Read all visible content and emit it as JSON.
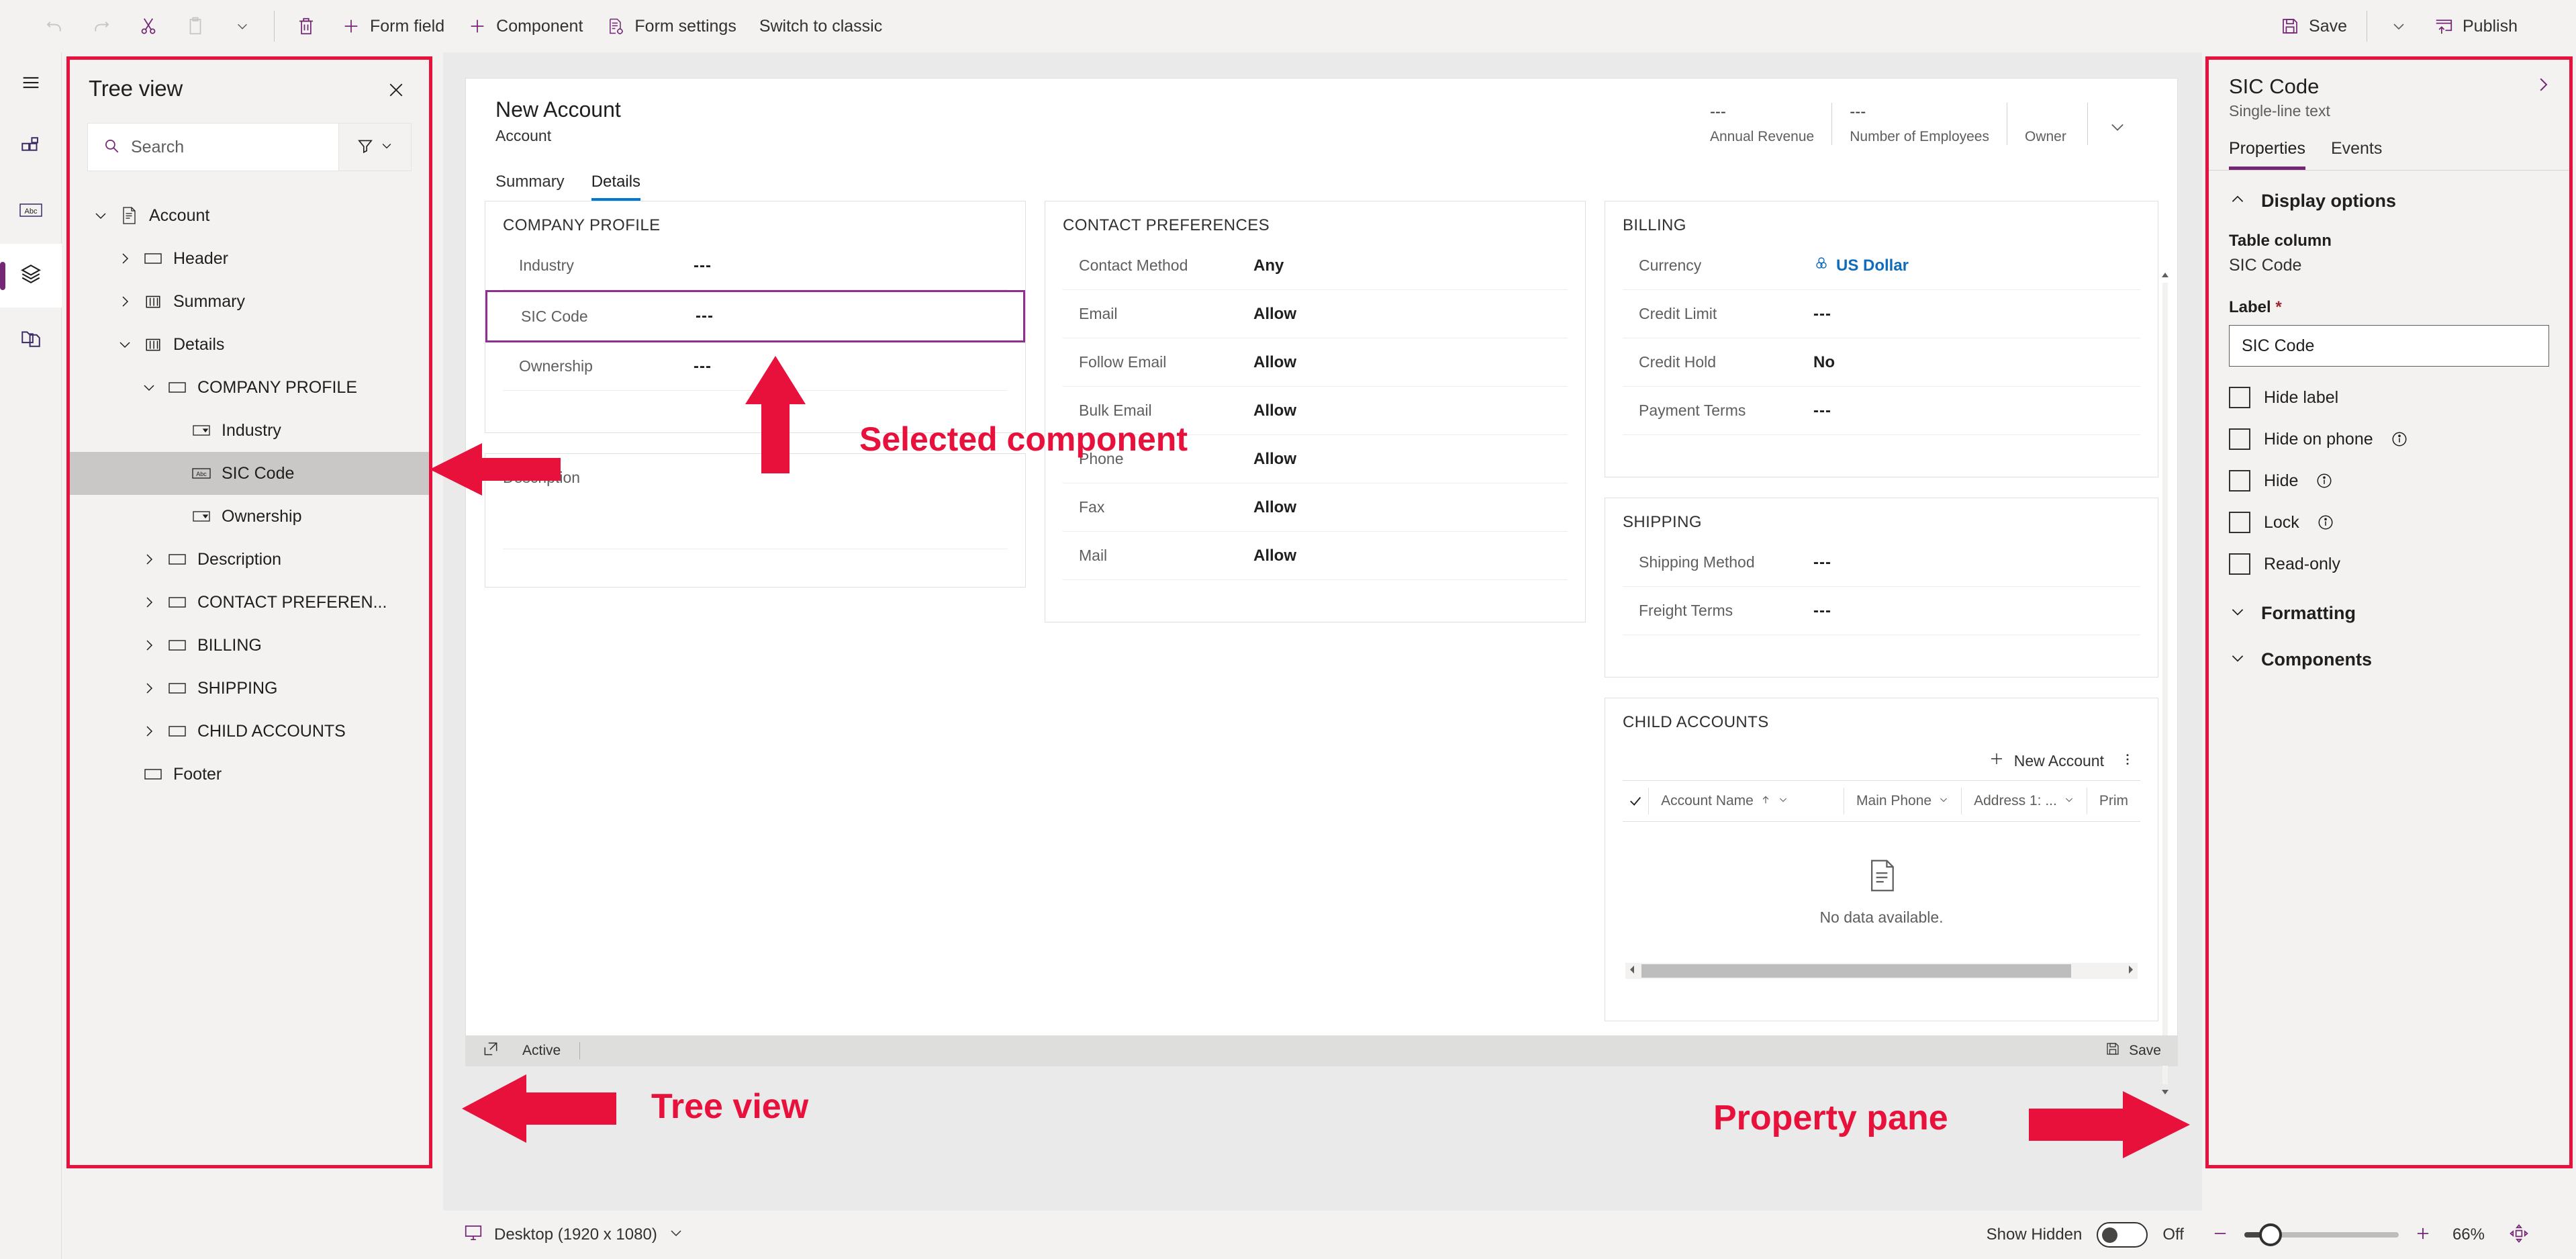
{
  "commandbar": {
    "buttons": [
      {
        "label": "",
        "icon": "undo-icon"
      },
      {
        "label": "",
        "icon": "redo-icon"
      },
      {
        "label": "",
        "icon": "cut-icon"
      },
      {
        "label": "",
        "icon": "paste-icon"
      },
      {
        "label": "",
        "icon": "chevron-down-icon"
      },
      {
        "label": "",
        "icon": "delete-icon"
      },
      {
        "label": "Form field",
        "icon": "plus-icon"
      },
      {
        "label": "Component",
        "icon": "plus-icon"
      },
      {
        "label": "Form settings",
        "icon": "form-settings-icon"
      },
      {
        "label": "Switch to classic",
        "icon": ""
      }
    ],
    "save_label": "Save",
    "publish_label": "Publish"
  },
  "rail": {
    "items": [
      {
        "name": "pages-icon"
      },
      {
        "name": "components-icon"
      },
      {
        "name": "table-columns-icon"
      },
      {
        "name": "tree-view-icon"
      },
      {
        "name": "related-icon"
      }
    ]
  },
  "treeview": {
    "title": "Tree view",
    "close_label": "Close",
    "search": {
      "placeholder": "Search",
      "value": ""
    },
    "items": [
      {
        "label": "Account",
        "depth": 0,
        "chev": "down",
        "icon": "form-icon",
        "selected": false
      },
      {
        "label": "Header",
        "depth": 1,
        "chev": "right",
        "icon": "section-icon",
        "selected": false
      },
      {
        "label": "Summary",
        "depth": 1,
        "chev": "right",
        "icon": "tab-icon",
        "selected": false
      },
      {
        "label": "Details",
        "depth": 1,
        "chev": "down",
        "icon": "tab-icon",
        "selected": false
      },
      {
        "label": "COMPANY PROFILE",
        "depth": 2,
        "chev": "down",
        "icon": "section-icon",
        "selected": false
      },
      {
        "label": "Industry",
        "depth": 3,
        "chev": "none",
        "icon": "choice-icon",
        "selected": false
      },
      {
        "label": "SIC Code",
        "depth": 3,
        "chev": "none",
        "icon": "abc-icon",
        "selected": true
      },
      {
        "label": "Ownership",
        "depth": 3,
        "chev": "none",
        "icon": "choice-icon",
        "selected": false
      },
      {
        "label": "Description",
        "depth": 2,
        "chev": "right",
        "icon": "section-icon",
        "selected": false
      },
      {
        "label": "CONTACT PREFEREN...",
        "depth": 2,
        "chev": "right",
        "icon": "section-icon",
        "selected": false
      },
      {
        "label": "BILLING",
        "depth": 2,
        "chev": "right",
        "icon": "section-icon",
        "selected": false
      },
      {
        "label": "SHIPPING",
        "depth": 2,
        "chev": "right",
        "icon": "section-icon",
        "selected": false
      },
      {
        "label": "CHILD ACCOUNTS",
        "depth": 2,
        "chev": "right",
        "icon": "section-icon",
        "selected": false
      },
      {
        "label": "Footer",
        "depth": 1,
        "chev": "none",
        "icon": "section-icon",
        "selected": false
      }
    ]
  },
  "form": {
    "title": "New Account",
    "subtitle": "Account",
    "tabs": [
      {
        "label": "Summary",
        "active": false
      },
      {
        "label": "Details",
        "active": true
      }
    ],
    "header_fields": [
      {
        "value": "---",
        "label": "Annual Revenue"
      },
      {
        "value": "---",
        "label": "Number of Employees"
      },
      {
        "value": "",
        "label": "Owner"
      }
    ],
    "company_profile": {
      "title": "COMPANY PROFILE",
      "rows": [
        {
          "label": "Industry",
          "value": "---",
          "selected": false
        },
        {
          "label": "SIC Code",
          "value": "---",
          "selected": true
        },
        {
          "label": "Ownership",
          "value": "---",
          "selected": false
        }
      ]
    },
    "description": {
      "label": "Description"
    },
    "contact_preferences": {
      "title": "CONTACT PREFERENCES",
      "rows": [
        {
          "label": "Contact Method",
          "value": "Any"
        },
        {
          "label": "Email",
          "value": "Allow"
        },
        {
          "label": "Follow Email",
          "value": "Allow"
        },
        {
          "label": "Bulk Email",
          "value": "Allow"
        },
        {
          "label": "Phone",
          "value": "Allow"
        },
        {
          "label": "Fax",
          "value": "Allow"
        },
        {
          "label": "Mail",
          "value": "Allow"
        }
      ]
    },
    "billing": {
      "title": "BILLING",
      "rows": [
        {
          "label": "Currency",
          "value": "US Dollar",
          "link": true
        },
        {
          "label": "Credit Limit",
          "value": "---"
        },
        {
          "label": "Credit Hold",
          "value": "No"
        },
        {
          "label": "Payment Terms",
          "value": "---"
        }
      ]
    },
    "shipping": {
      "title": "SHIPPING",
      "rows": [
        {
          "label": "Shipping Method",
          "value": "---"
        },
        {
          "label": "Freight Terms",
          "value": "---"
        }
      ]
    },
    "child_accounts": {
      "title": "CHILD ACCOUNTS",
      "new_label": "New Account",
      "more_label": "More commands",
      "columns": [
        "Account Name",
        "Main Phone",
        "Address 1: ...",
        "Prim"
      ],
      "empty_text": "No data available."
    },
    "status": {
      "state": "Active",
      "save_label": "Save"
    }
  },
  "properties": {
    "title": "SIC Code",
    "subtitle": "Single-line text",
    "tabs": [
      {
        "label": "Properties",
        "active": true
      },
      {
        "label": "Events",
        "active": false
      }
    ],
    "display_options": {
      "section_title": "Display options",
      "table_column_label": "Table column",
      "table_column_value": "SIC Code",
      "label_label": "Label",
      "label_required": "*",
      "label_value": "SIC Code",
      "checkboxes": [
        {
          "label": "Hide label",
          "checked": false,
          "info": false
        },
        {
          "label": "Hide on phone",
          "checked": false,
          "info": true
        },
        {
          "label": "Hide",
          "checked": false,
          "info": true
        },
        {
          "label": "Lock",
          "checked": false,
          "info": true
        },
        {
          "label": "Read-only",
          "checked": false,
          "info": false
        }
      ]
    },
    "sections": [
      {
        "title": "Formatting",
        "expanded": false
      },
      {
        "title": "Components",
        "expanded": false
      }
    ]
  },
  "bottombar": {
    "device_label": "Desktop (1920 x 1080)",
    "show_hidden_label": "Show Hidden",
    "show_hidden_state": "Off",
    "zoom_level": "66%"
  },
  "annotations": [
    {
      "text": "Selected component"
    },
    {
      "text": "Tree view"
    },
    {
      "text": "Property pane"
    }
  ],
  "colors": {
    "accent": "#742774",
    "annotation": "#e8113c",
    "link": "#0f6cbd",
    "selection": "#8f2f8f"
  }
}
